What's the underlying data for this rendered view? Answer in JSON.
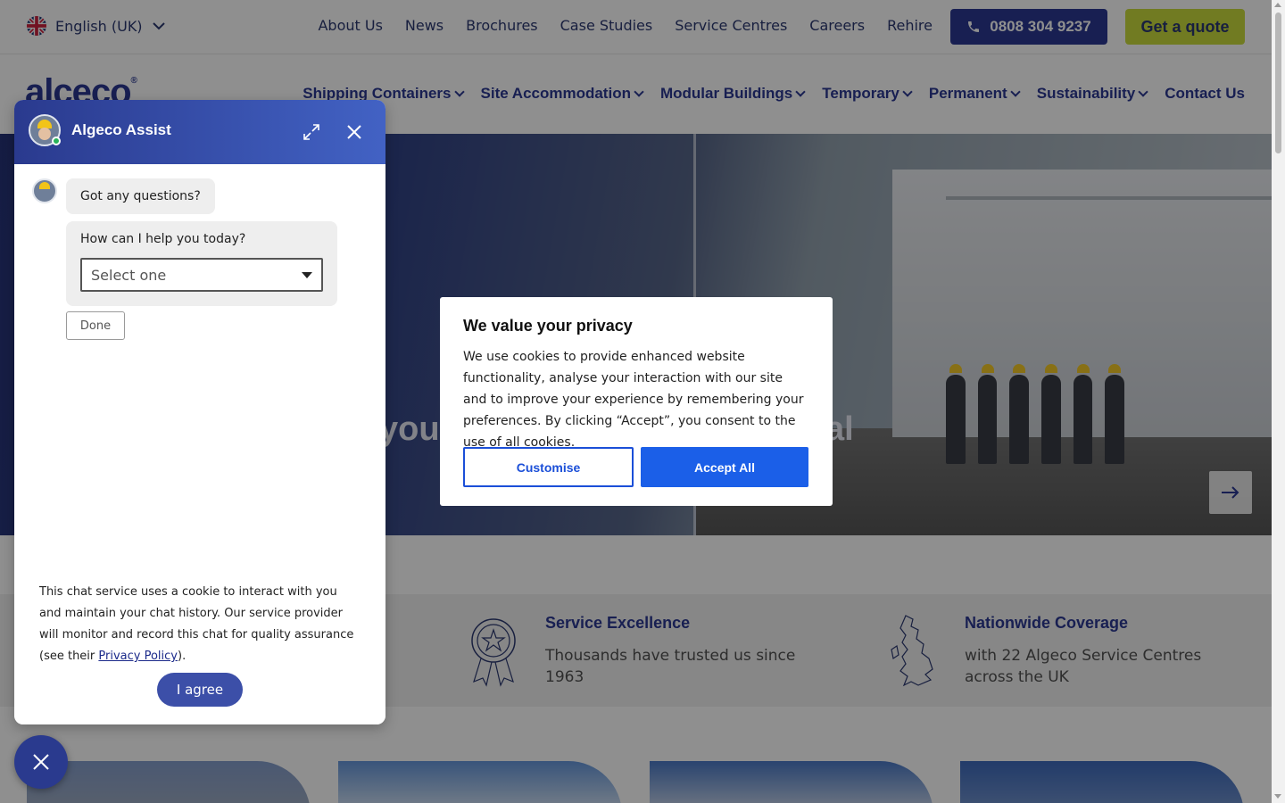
{
  "topbar": {
    "language": "English (UK)",
    "links": [
      "About Us",
      "News",
      "Brochures",
      "Case Studies",
      "Service Centres",
      "Careers",
      "Rehire"
    ],
    "phone": "0808 304 9237",
    "quote": "Get a quote"
  },
  "nav": {
    "logo": "alceco",
    "items": [
      "Shipping Containers",
      "Site Accommodation",
      "Modular Buildings",
      "Temporary",
      "Permanent",
      "Sustainability",
      "Contact Us"
    ]
  },
  "hero": {
    "text_left": "your",
    "text_right": "al"
  },
  "features": [
    {
      "title": "Service Excellence",
      "text": "Thousands have trusted us since 1963"
    },
    {
      "title": "Nationwide Coverage",
      "text": "with 22 Algeco Service Centres across the UK"
    }
  ],
  "privacy": {
    "title": "We value your privacy",
    "body": "We use cookies to provide enhanced website functionality, analyse your interaction with our site and to improve your experience by remembering your preferences. By clicking “Accept”, you consent to the use of all cookies.",
    "customise": "Customise",
    "accept": "Accept All"
  },
  "chat": {
    "title": "Algeco Assist",
    "message1": "Got any questions?",
    "message2": "How can I help you today?",
    "select_placeholder": "Select one",
    "done": "Done",
    "consent_text": "This chat service uses a cookie to interact with you and maintain your chat history. Our service provider will monitor and record this chat for quality assurance (see their ",
    "privacy_link": "Privacy Policy",
    "consent_end": ").",
    "agree": "I agree"
  },
  "colors": {
    "brand_navy": "#1b2a8a",
    "brand_lime": "#c6d82e",
    "accept_blue": "#1b5fe8"
  }
}
